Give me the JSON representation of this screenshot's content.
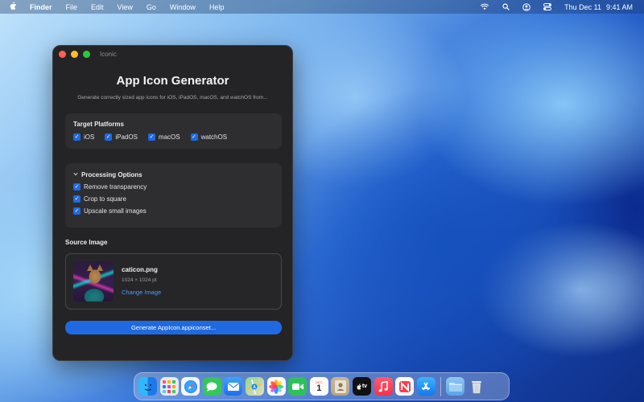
{
  "menubar": {
    "apple_icon": "apple-logo",
    "app_name": "Finder",
    "menus": [
      "File",
      "Edit",
      "View",
      "Go",
      "Window",
      "Help"
    ],
    "status_icons": [
      "wifi-icon",
      "search-icon",
      "user-icon",
      "control-center-icon"
    ],
    "date": "Thu Dec 11",
    "time": "9:41 AM"
  },
  "window": {
    "title": "Iconic",
    "heading": "App Icon Generator",
    "subtitle": "Generate correctly sized app icons for iOS, iPadOS, macOS, and watchOS from...",
    "platforms": {
      "title": "Target Platforms",
      "items": [
        {
          "label": "iOS",
          "checked": true
        },
        {
          "label": "iPadOS",
          "checked": true
        },
        {
          "label": "macOS",
          "checked": true
        },
        {
          "label": "watchOS",
          "checked": true
        }
      ]
    },
    "processing": {
      "title": "Processing Options",
      "items": [
        {
          "label": "Remove transparency",
          "checked": true
        },
        {
          "label": "Crop to square",
          "checked": true
        },
        {
          "label": "Upscale small images",
          "checked": true
        }
      ]
    },
    "source": {
      "section_label": "Source Image",
      "file_name": "caticon.png",
      "dimensions": "1024 × 1024 pt",
      "change_label": "Change Image"
    },
    "generate_label": "Generate AppIcon.appiconset..."
  },
  "dock": {
    "apps": [
      "Finder",
      "Launchpad",
      "Safari",
      "Messages",
      "Mail",
      "Maps",
      "Photos",
      "FaceTime",
      "Calendar",
      "Contacts",
      "TV",
      "Music",
      "News",
      "App Store"
    ],
    "calendar": {
      "month": "DEC",
      "day": "1"
    },
    "tv_label": "tv",
    "extras": [
      "Downloads",
      "Trash"
    ]
  },
  "colors": {
    "accent": "#1f6ae0",
    "link": "#4d9bff",
    "window_bg": "#242426",
    "card_bg": "#2e2e31"
  }
}
